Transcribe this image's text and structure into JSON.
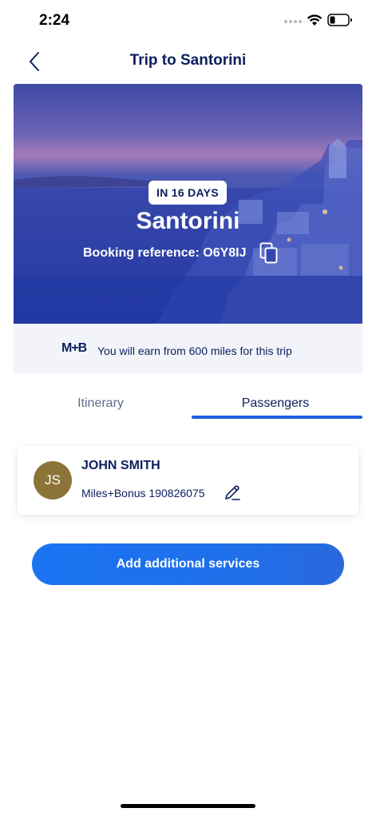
{
  "status_bar": {
    "time": "2:24"
  },
  "nav": {
    "title": "Trip to Santorini",
    "back_icon": "chevron-left-icon"
  },
  "hero": {
    "badge": "IN 16 DAYS",
    "city": "Santorini",
    "booking_reference": "Booking reference: O6Y8IJ",
    "copy_icon": "copy-icon"
  },
  "miles": {
    "logo": "M+B",
    "text": "You will earn from 600 miles for this trip"
  },
  "tabs": [
    {
      "label": "Itinerary",
      "active": false
    },
    {
      "label": "Passengers",
      "active": true
    }
  ],
  "passenger": {
    "initials": "JS",
    "name": "JOHN SMITH",
    "membership": "Miles+Bonus 190826075",
    "edit_icon": "pencil-icon"
  },
  "cta": {
    "label": "Add additional services"
  },
  "colors": {
    "accent": "#1f6fe8",
    "navy": "#0c1f5e",
    "avatar": "#8c7438",
    "banner": "#f3f4f9"
  }
}
